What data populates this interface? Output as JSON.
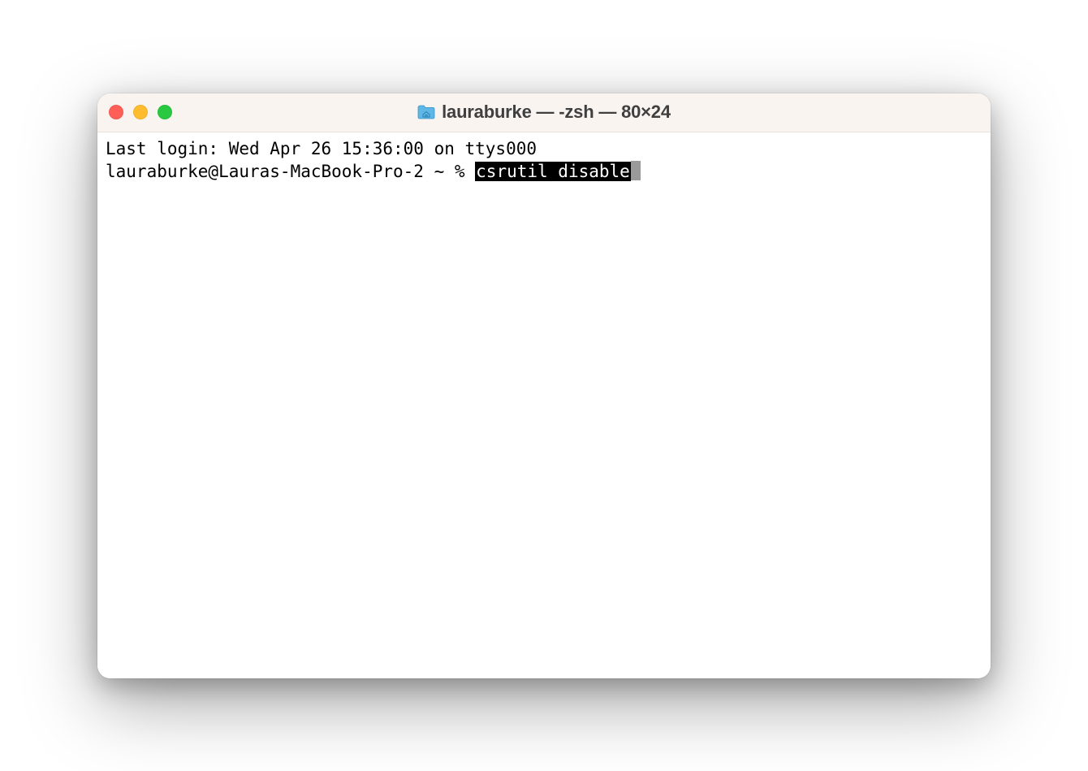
{
  "window": {
    "title": "lauraburke — -zsh — 80×24"
  },
  "terminal": {
    "last_login": "Last login: Wed Apr 26 15:36:00 on ttys000",
    "prompt": "lauraburke@Lauras-MacBook-Pro-2 ~ % ",
    "command": "csrutil disable"
  }
}
